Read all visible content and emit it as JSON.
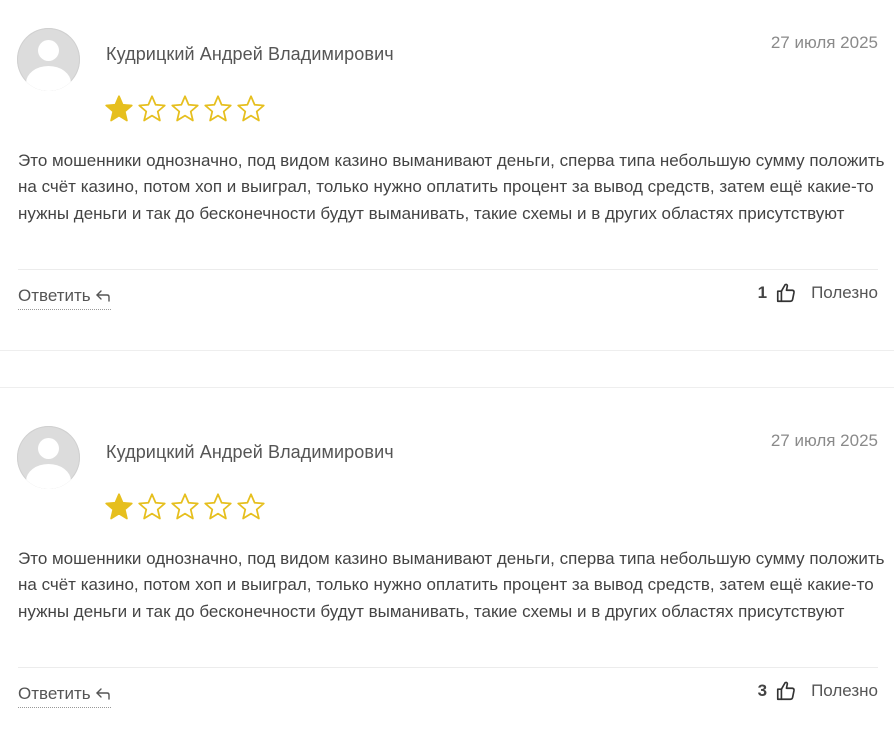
{
  "colors": {
    "star_filled": "#E6BF1E",
    "star_outline": "#E6BF1E",
    "divider": "#ECECEC"
  },
  "reviews": [
    {
      "author": "Кудрицкий Андрей Владимирович",
      "date": "27 июля 2025",
      "rating": 1,
      "rating_max": 5,
      "text": "Это мошенники однозначно, под видом казино выманивают деньги, сперва типа небольшую сумму положить на счёт казино, потом хоп и выиграл, только нужно оплатить процент за вывод средств, затем ещё какие-то нужны деньги и так до бесконечности будут выманивать, такие схемы и в других областях присутствуют",
      "reply_label": "Ответить",
      "helpful_count": "1",
      "helpful_label": "Полезно"
    },
    {
      "author": "Кудрицкий Андрей Владимирович",
      "date": "27 июля 2025",
      "rating": 1,
      "rating_max": 5,
      "text": "Это мошенники однозначно, под видом казино выманивают деньги, сперва типа небольшую сумму положить на счёт казино, потом хоп и выиграл, только нужно оплатить процент за вывод средств, затем ещё какие-то нужны деньги и так до бесконечности будут выманивать, такие схемы и в других областях присутствуют",
      "reply_label": "Ответить",
      "helpful_count": "3",
      "helpful_label": "Полезно"
    }
  ]
}
